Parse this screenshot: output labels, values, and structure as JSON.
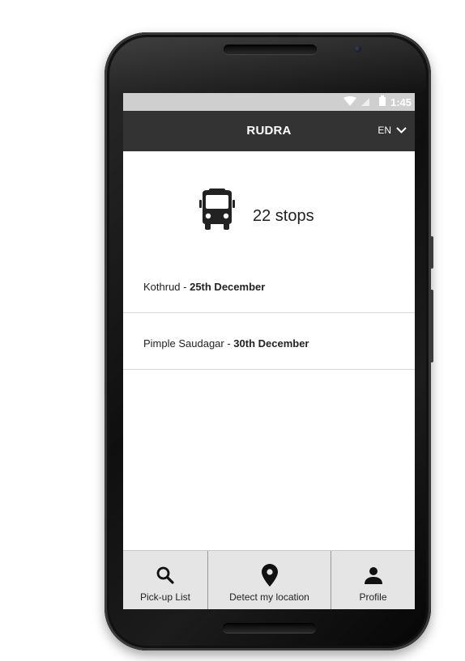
{
  "status_bar": {
    "time": "1:45",
    "icons": [
      "wifi-icon",
      "signal-icon",
      "battery-icon"
    ]
  },
  "app_bar": {
    "title": "RUDRA",
    "language": "EN",
    "language_icon": "chevron-down-icon"
  },
  "summary": {
    "icon": "bus-icon",
    "stops_label": "22 stops"
  },
  "stops": [
    {
      "place": "Kothrud - ",
      "date": "25th December"
    },
    {
      "place": "Pimple Saudagar - ",
      "date": "30th December"
    }
  ],
  "bottom_nav": [
    {
      "icon": "search-icon",
      "label": "Pick-up List"
    },
    {
      "icon": "location-pin-icon",
      "label": "Detect my location"
    },
    {
      "icon": "person-icon",
      "label": "Profile"
    }
  ],
  "colors": {
    "status_bar_bg": "#cfcfcf",
    "app_bar_bg": "#333333",
    "bottom_nav_bg": "#e5e5e5",
    "text": "#222222"
  }
}
